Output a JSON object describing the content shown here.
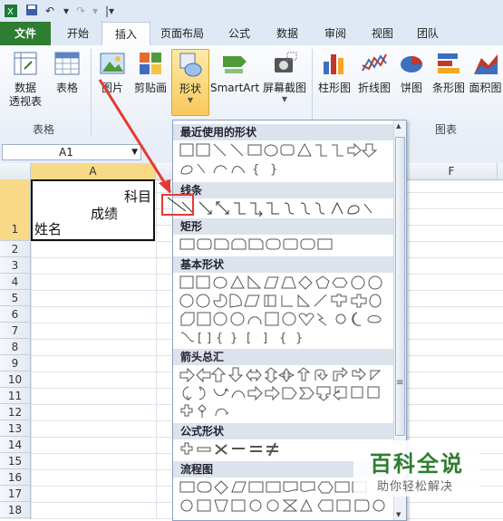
{
  "ribbon_tabs": [
    "文件",
    "开始",
    "插入",
    "页面布局",
    "公式",
    "数据",
    "审阅",
    "视图",
    "团队"
  ],
  "ribbon": {
    "pivot": "数据\n透视表",
    "table": "表格",
    "picture": "图片",
    "clipart": "剪贴画",
    "shapes": "形状",
    "smartart": "SmartArt",
    "screenshot": "屏幕截图",
    "column_chart": "柱形图",
    "line_chart": "折线图",
    "pie_chart": "饼图",
    "bar_chart": "条形图",
    "area_chart": "面积图",
    "group_tables": "表格",
    "group_charts": "图表"
  },
  "namebox": {
    "value": "A1"
  },
  "columns": [
    "A",
    "F"
  ],
  "rows": [
    "1",
    "2",
    "3",
    "4",
    "5",
    "6",
    "7",
    "8",
    "9",
    "10",
    "11",
    "12",
    "13",
    "14",
    "15",
    "16",
    "17",
    "18"
  ],
  "cell_a1": {
    "top_right": "科目",
    "middle": "成绩",
    "bottom_left": "姓名"
  },
  "gallery": {
    "recent": "最近使用的形状",
    "lines": "线条",
    "rectangles": "矩形",
    "basic": "基本形状",
    "arrows": "箭头总汇",
    "equation": "公式形状",
    "flowchart": "流程图"
  },
  "watermark": {
    "line1": "百科全说",
    "line2": "助你轻松解决"
  },
  "colors": {
    "accent": "#2e7d32",
    "highlight": "#e53935",
    "selected_button": "#f8c95b"
  }
}
